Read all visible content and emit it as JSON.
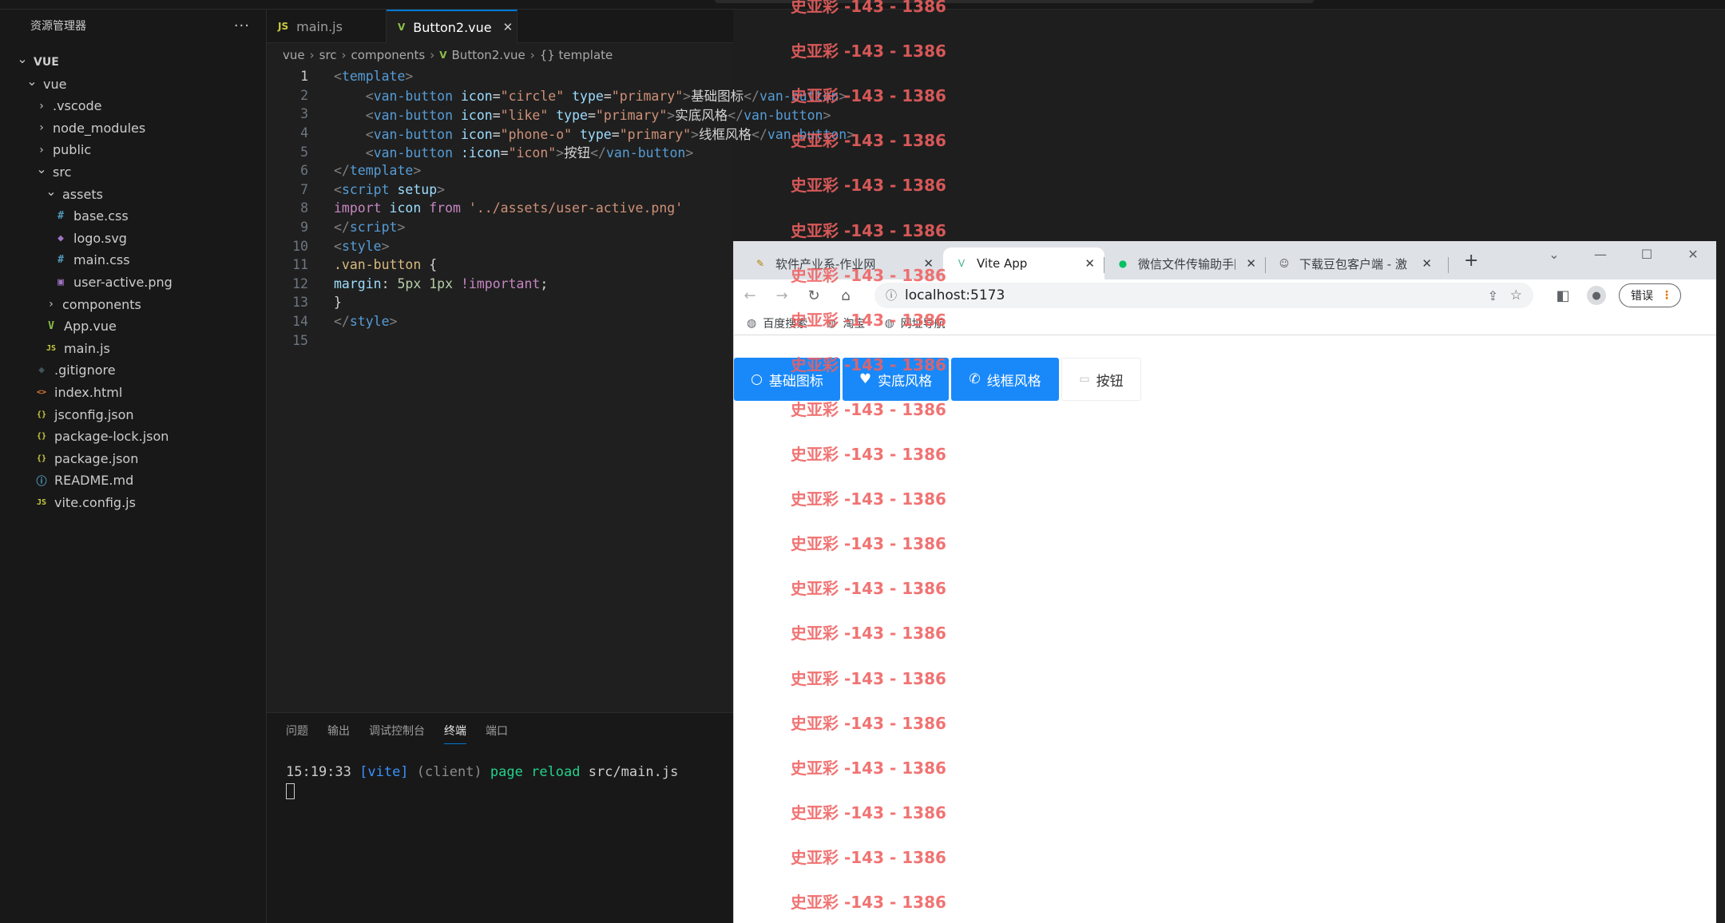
{
  "explorer": {
    "title": "资源管理器",
    "more": "···",
    "items": [
      {
        "label": "VUE",
        "depth": 0,
        "chev": "v",
        "bold": true
      },
      {
        "label": "vue",
        "depth": 1,
        "chev": "v"
      },
      {
        "label": ".vscode",
        "depth": 2,
        "chev": ">"
      },
      {
        "label": "node_modules",
        "depth": 2,
        "chev": ">"
      },
      {
        "label": "public",
        "depth": 2,
        "chev": ">"
      },
      {
        "label": "src",
        "depth": 2,
        "chev": "v"
      },
      {
        "label": "assets",
        "depth": 3,
        "chev": "v"
      },
      {
        "label": "base.css",
        "depth": 4,
        "icon": "#",
        "color": "#519aba"
      },
      {
        "label": "logo.svg",
        "depth": 4,
        "icon": "◆",
        "color": "#a074c4"
      },
      {
        "label": "main.css",
        "depth": 4,
        "icon": "#",
        "color": "#519aba"
      },
      {
        "label": "user-active.png",
        "depth": 4,
        "icon": "▣",
        "color": "#a074c4"
      },
      {
        "label": "components",
        "depth": 3,
        "chev": ">"
      },
      {
        "label": "App.vue",
        "depth": 3,
        "icon": "V",
        "color": "#8dc149"
      },
      {
        "label": "main.js",
        "depth": 3,
        "icon": "JS",
        "color": "#cbcb41"
      },
      {
        "label": ".gitignore",
        "depth": 2,
        "icon": "◆",
        "color": "#41535b"
      },
      {
        "label": "index.html",
        "depth": 2,
        "icon": "<>",
        "color": "#e37933"
      },
      {
        "label": "jsconfig.json",
        "depth": 2,
        "icon": "{}",
        "color": "#cbcb41"
      },
      {
        "label": "package-lock.json",
        "depth": 2,
        "icon": "{}",
        "color": "#cbcb41"
      },
      {
        "label": "package.json",
        "depth": 2,
        "icon": "{}",
        "color": "#cbcb41"
      },
      {
        "label": "README.md",
        "depth": 2,
        "icon": "ⓘ",
        "color": "#519aba"
      },
      {
        "label": "vite.config.js",
        "depth": 2,
        "icon": "JS",
        "color": "#cbcb41"
      }
    ]
  },
  "tabs": [
    {
      "label": "main.js",
      "icon": "JS",
      "color": "#cbcb41",
      "active": false
    },
    {
      "label": "Button2.vue",
      "icon": "V",
      "color": "#8dc149",
      "active": true,
      "close": "✕"
    }
  ],
  "breadcrumb": [
    "vue",
    "src",
    "components",
    "Button2.vue",
    "{} template"
  ],
  "code": [
    [
      [
        "c-tag",
        "<"
      ],
      [
        "c-tn",
        "template"
      ],
      [
        "c-tag",
        ">"
      ]
    ],
    [
      [
        "c-txt",
        "    "
      ],
      [
        "c-tag",
        "<"
      ],
      [
        "c-tn",
        "van-button"
      ],
      [
        "c-txt",
        " "
      ],
      [
        "c-at",
        "icon"
      ],
      [
        "c-txt",
        "="
      ],
      [
        "c-str",
        "\"circle\""
      ],
      [
        "c-txt",
        " "
      ],
      [
        "c-at",
        "type"
      ],
      [
        "c-txt",
        "="
      ],
      [
        "c-str",
        "\"primary\""
      ],
      [
        "c-tag",
        ">"
      ],
      [
        "c-txt",
        "基础图标"
      ],
      [
        "c-tag",
        "</"
      ],
      [
        "c-tn",
        "van-button"
      ],
      [
        "c-tag",
        ">"
      ]
    ],
    [
      [
        "c-txt",
        "    "
      ],
      [
        "c-tag",
        "<"
      ],
      [
        "c-tn",
        "van-button"
      ],
      [
        "c-txt",
        " "
      ],
      [
        "c-at",
        "icon"
      ],
      [
        "c-txt",
        "="
      ],
      [
        "c-str",
        "\"like\""
      ],
      [
        "c-txt",
        " "
      ],
      [
        "c-at",
        "type"
      ],
      [
        "c-txt",
        "="
      ],
      [
        "c-str",
        "\"primary\""
      ],
      [
        "c-tag",
        ">"
      ],
      [
        "c-txt",
        "实底风格"
      ],
      [
        "c-tag",
        "</"
      ],
      [
        "c-tn",
        "van-button"
      ],
      [
        "c-tag",
        ">"
      ]
    ],
    [
      [
        "c-txt",
        "    "
      ],
      [
        "c-tag",
        "<"
      ],
      [
        "c-tn",
        "van-button"
      ],
      [
        "c-txt",
        " "
      ],
      [
        "c-at",
        "icon"
      ],
      [
        "c-txt",
        "="
      ],
      [
        "c-str",
        "\"phone-o\""
      ],
      [
        "c-txt",
        " "
      ],
      [
        "c-at",
        "type"
      ],
      [
        "c-txt",
        "="
      ],
      [
        "c-str",
        "\"primary\""
      ],
      [
        "c-tag",
        ">"
      ],
      [
        "c-txt",
        "线框风格"
      ],
      [
        "c-tag",
        "</"
      ],
      [
        "c-tn",
        "van-button"
      ],
      [
        "c-tag",
        ">"
      ]
    ],
    [
      [
        "c-txt",
        "    "
      ],
      [
        "c-tag",
        "<"
      ],
      [
        "c-tn",
        "van-button"
      ],
      [
        "c-txt",
        " "
      ],
      [
        "c-at",
        ":icon"
      ],
      [
        "c-txt",
        "="
      ],
      [
        "c-str",
        "\"icon\""
      ],
      [
        "c-tag",
        ">"
      ],
      [
        "c-txt",
        "按钮"
      ],
      [
        "c-tag",
        "</"
      ],
      [
        "c-tn",
        "van-button"
      ],
      [
        "c-tag",
        ">"
      ]
    ],
    [
      [
        "c-tag",
        "</"
      ],
      [
        "c-tn",
        "template"
      ],
      [
        "c-tag",
        ">"
      ]
    ],
    [
      [
        "c-tag",
        "<"
      ],
      [
        "c-tn",
        "script"
      ],
      [
        "c-txt",
        " "
      ],
      [
        "c-at",
        "setup"
      ],
      [
        "c-tag",
        ">"
      ]
    ],
    [
      [
        "c-kw",
        "import"
      ],
      [
        "c-txt",
        " "
      ],
      [
        "c-id",
        "icon"
      ],
      [
        "c-txt",
        " "
      ],
      [
        "c-kw",
        "from"
      ],
      [
        "c-txt",
        " "
      ],
      [
        "c-str",
        "'../assets/user-active.png'"
      ]
    ],
    [
      [
        "c-tag",
        "</"
      ],
      [
        "c-tn",
        "script"
      ],
      [
        "c-tag",
        ">"
      ]
    ],
    [
      [
        "c-tag",
        "<"
      ],
      [
        "c-tn",
        "style"
      ],
      [
        "c-tag",
        ">"
      ]
    ],
    [
      [
        "c-sel",
        ".van-button"
      ],
      [
        "c-txt",
        " {"
      ]
    ],
    [
      [
        "c-prop",
        "margin"
      ],
      [
        "c-txt",
        ": "
      ],
      [
        "c-num",
        "5px"
      ],
      [
        "c-txt",
        " "
      ],
      [
        "c-num",
        "1px"
      ],
      [
        "c-txt",
        " "
      ],
      [
        "c-kw",
        "!important"
      ],
      [
        "c-txt",
        ";"
      ]
    ],
    [
      [
        "c-txt",
        "}"
      ]
    ],
    [
      [
        "c-tag",
        "</"
      ],
      [
        "c-tn",
        "style"
      ],
      [
        "c-tag",
        ">"
      ]
    ],
    [
      [
        "c-txt",
        ""
      ]
    ]
  ],
  "panel": {
    "tabs": [
      "问题",
      "输出",
      "调试控制台",
      "终端",
      "端口"
    ],
    "active": 3,
    "terminal": [
      [
        "#cccccc",
        "15:19:33 "
      ],
      [
        "#3794ff",
        "[vite] "
      ],
      [
        "#8b8b8b",
        "(client) "
      ],
      [
        "#23d18b",
        "page reload "
      ],
      [
        "#cccccc",
        "src/main.js"
      ]
    ]
  },
  "browser": {
    "tabs": [
      {
        "label": "软件产业系-作业网",
        "fav": "✎",
        "favcolor": "#b08000",
        "active": false,
        "close": "✕"
      },
      {
        "label": "Vite App",
        "fav": "V",
        "favcolor": "#41b883",
        "active": true,
        "close": "✕"
      },
      {
        "label": "微信文件传输助手网页",
        "fav": "●",
        "favcolor": "#07c160",
        "active": false,
        "close": "✕"
      },
      {
        "label": "下载豆包客户端 - 激",
        "fav": "☺",
        "favcolor": "#555555",
        "active": false,
        "close": "✕"
      }
    ],
    "newtab": "+",
    "winctl": [
      "⌄",
      "—",
      "☐",
      "✕"
    ],
    "url": "localhost:5173",
    "error_btn": "错误",
    "bookmarks": [
      "百度搜索",
      "淘宝",
      "网址导航"
    ]
  },
  "vant_buttons": [
    {
      "label": "基础图标",
      "icon": "○",
      "type": "primary"
    },
    {
      "label": "实底风格",
      "icon": "♥",
      "type": "primary"
    },
    {
      "label": "线框风格",
      "icon": "✆",
      "type": "primary"
    },
    {
      "label": "按钮",
      "icon": "▭",
      "type": "default"
    }
  ],
  "watermark": {
    "text": "史亚彩 -143 - 1386",
    "count": 21
  }
}
